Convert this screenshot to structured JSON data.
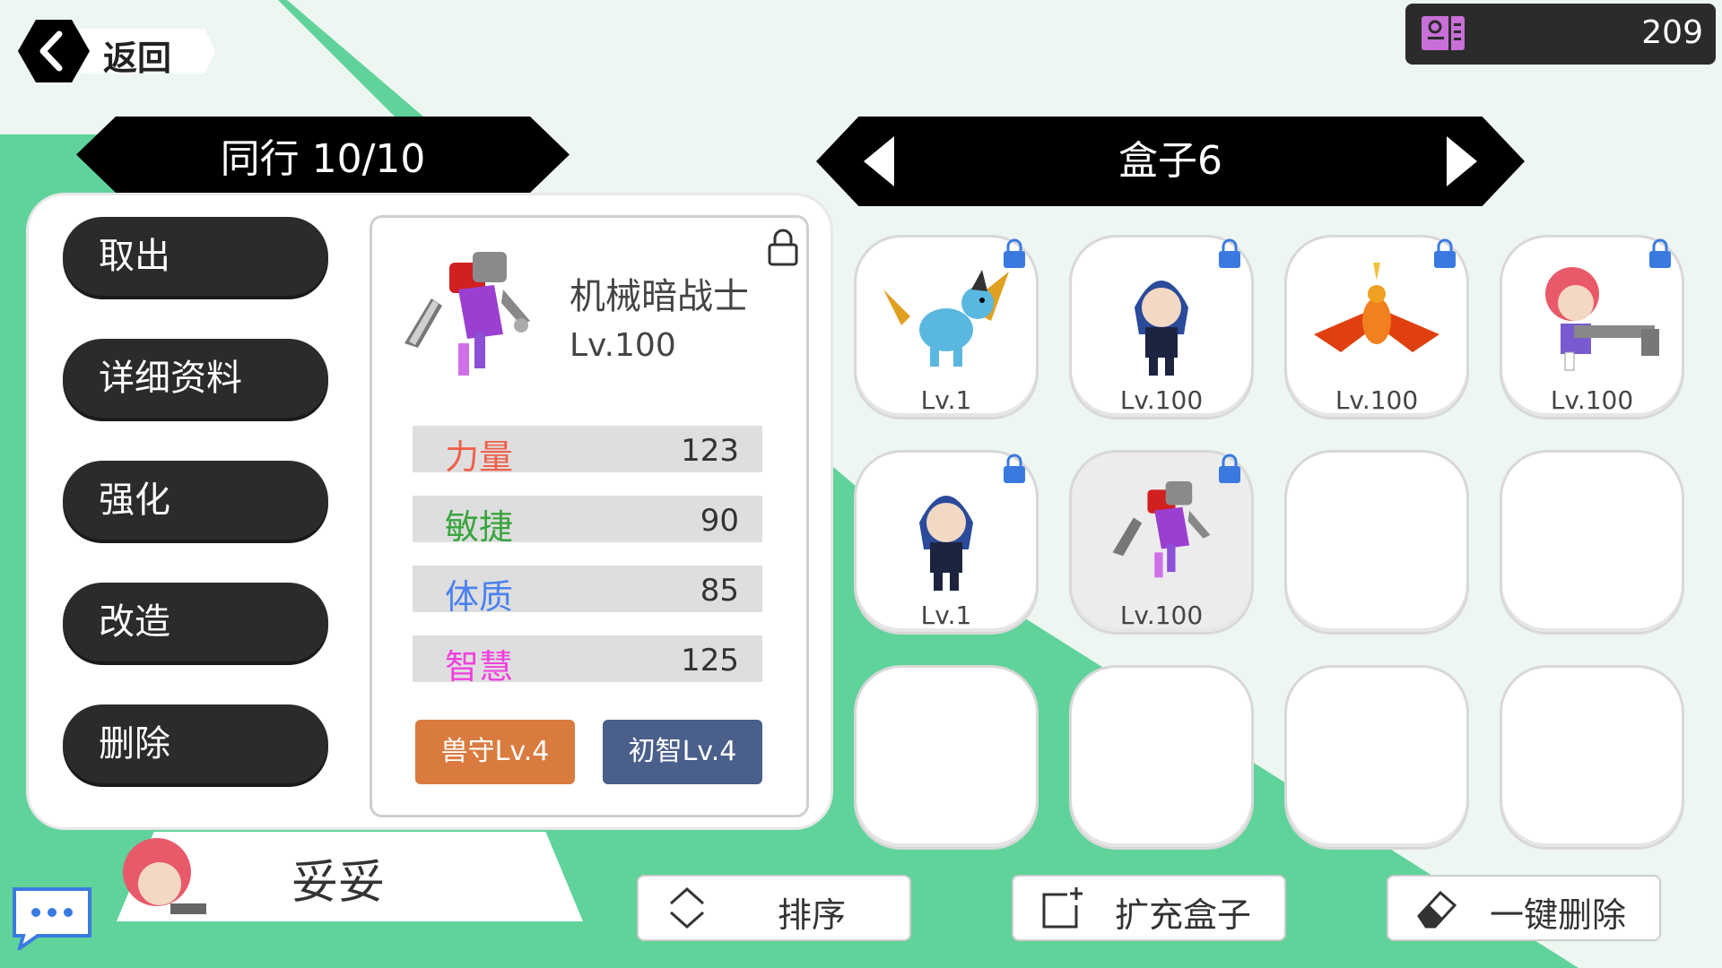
{
  "header": {
    "back_label": "返回",
    "currency_icon": "ticket-icon",
    "currency_value": "209"
  },
  "party": {
    "title": "同行 10/10"
  },
  "box": {
    "title": "盒子6"
  },
  "actions": [
    "取出",
    "详细资料",
    "强化",
    "改造",
    "删除"
  ],
  "selected": {
    "name": "机械暗战士",
    "level": "Lv.100",
    "locked": true,
    "stats": [
      {
        "name": "力量",
        "value": "123",
        "color": "#f0604a"
      },
      {
        "name": "敏捷",
        "value": "90",
        "color": "#3aa53f"
      },
      {
        "name": "体质",
        "value": "85",
        "color": "#4a82f0"
      },
      {
        "name": "智慧",
        "value": "125",
        "color": "#f040e0"
      }
    ],
    "skills": [
      {
        "label": "兽守Lv.4",
        "color": "#d97b3f"
      },
      {
        "label": "初智Lv.4",
        "color": "#4a5f8a"
      }
    ]
  },
  "slots": [
    {
      "creature": "blue-dragon",
      "level": "Lv.1",
      "locked": true
    },
    {
      "creature": "blue-hair-swordsman",
      "level": "Lv.100",
      "locked": true
    },
    {
      "creature": "fire-phoenix",
      "level": "Lv.100",
      "locked": true
    },
    {
      "creature": "red-hair-gunner",
      "level": "Lv.100",
      "locked": true
    },
    {
      "creature": "blue-hair-swordsman",
      "level": "Lv.1",
      "locked": true
    },
    {
      "creature": "mech-dark-warrior",
      "level": "Lv.100",
      "locked": true,
      "selected": true
    },
    {},
    {},
    {},
    {},
    {},
    {}
  ],
  "companion": {
    "name": "妥妥"
  },
  "bottom": {
    "sort": "排序",
    "expand": "扩充盒子",
    "delete_all": "一键删除"
  },
  "colors": {
    "bg_green": "#5fd39a",
    "bg_light": "#eef7f1",
    "dark": "#2b2b2b"
  }
}
